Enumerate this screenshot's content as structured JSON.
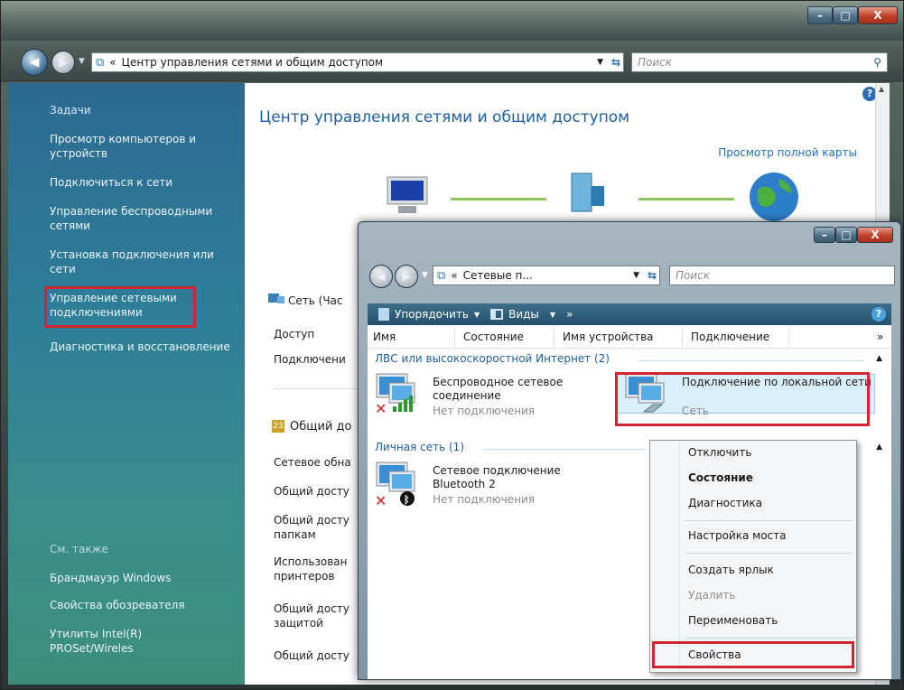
{
  "window_main": {
    "caption_min": "–",
    "caption_max": "□",
    "caption_close": "X",
    "breadcrumb_sep": "«",
    "address": "Центр управления сетями и общим доступом",
    "search_placeholder": "Поиск",
    "title": "Центр управления сетями и общим доступом",
    "full_map_link": "Просмотр полной карты",
    "help": "?"
  },
  "tasks": {
    "header": "Задачи",
    "items": [
      "Просмотр компьютеров и устройств",
      "Подключиться к сети",
      "Управление беспроводными сетями",
      "Установка подключения или сети",
      "Управление сетевыми подключениями",
      "Диагностика и восстановление"
    ],
    "see_also_header": "См. также",
    "see_also": [
      "Брандмауэр Windows",
      "Свойства обозревателя",
      "Утилиты Intel(R) PROSet/Wireles"
    ]
  },
  "main_rows": {
    "network": "Сеть (Час",
    "access": "Доступ",
    "connection": "Подключени",
    "sharing_header": "Общий до",
    "sharing": [
      "Сетевое обна",
      "Общий досту",
      "Общий досту папкам",
      "Использован принтеров",
      "Общий досту защитой",
      "Общий досту"
    ]
  },
  "window_conn": {
    "address": "Сетевые п...",
    "search_placeholder": "Поиск",
    "toolbar": {
      "organize": "Упорядочить",
      "views": "Виды",
      "more": "»"
    },
    "columns": [
      "Имя",
      "Состояние",
      "Имя устройства",
      "Подключение"
    ],
    "more_cols": "»",
    "groups": [
      {
        "title": "ЛВС или высокоскоростной Интернет (2)"
      },
      {
        "title": "Личная сеть (1)"
      }
    ],
    "connections": [
      {
        "name": "Беспроводное сетевое соединение",
        "status": "Нет подключения"
      },
      {
        "name": "Подключение по локальной сети",
        "status": "Сеть"
      },
      {
        "name": "Сетевое подключение Bluetooth 2",
        "status": "Нет подключения"
      }
    ]
  },
  "context_menu": {
    "items": [
      {
        "label": "Отключить"
      },
      {
        "label": "Состояние"
      },
      {
        "label": "Диагностика"
      },
      {
        "label": "Настройка моста"
      },
      {
        "label": "Создать ярлык"
      },
      {
        "label": "Удалить"
      },
      {
        "label": "Переименовать"
      },
      {
        "label": "Свойства"
      }
    ]
  },
  "colors": {
    "highlight_box": "#d32432",
    "link": "#1f5fa3",
    "pane": "#2e7f98"
  }
}
